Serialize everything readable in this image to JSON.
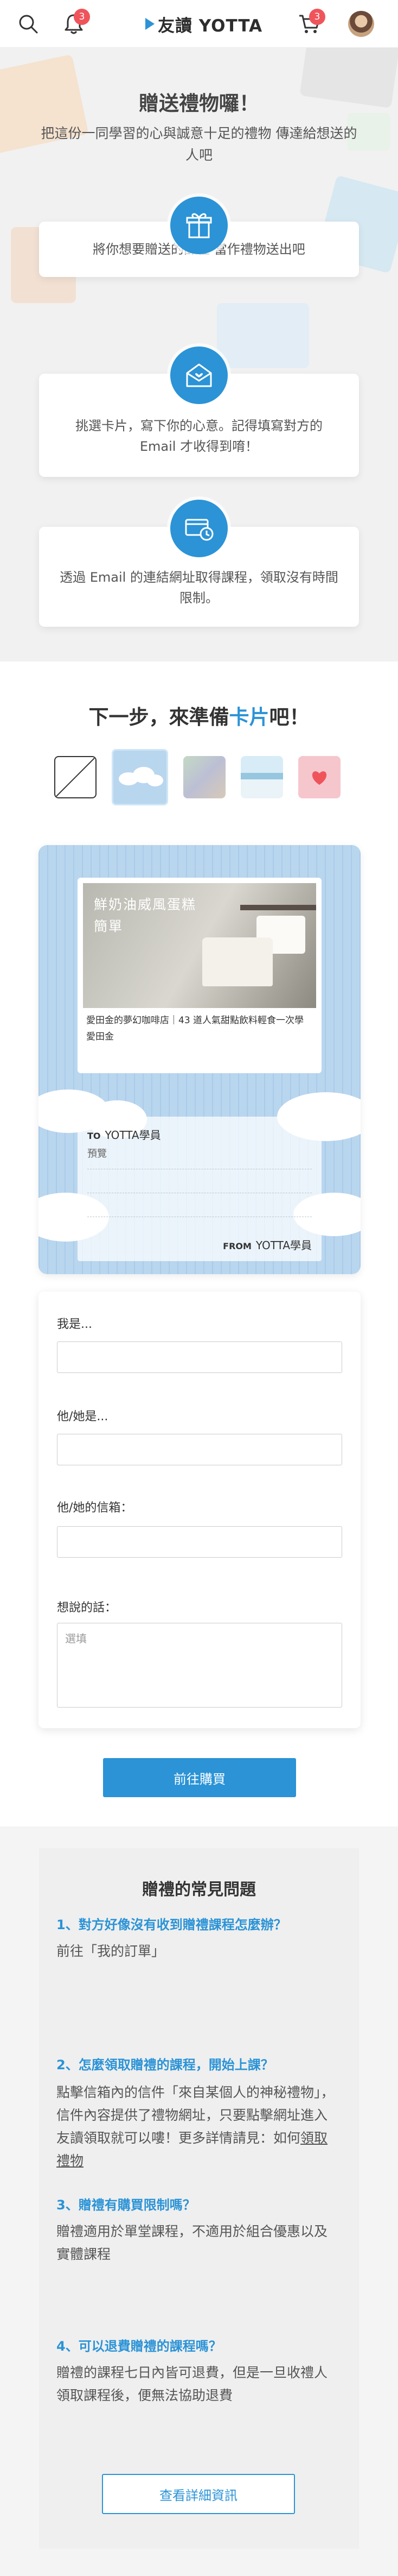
{
  "header": {
    "logo_text": "友讀 YOTTA",
    "notification_count": "3",
    "cart_count": "3"
  },
  "hero": {
    "title": "贈送禮物囉！",
    "subtitle": "把這份一同學習的心與誠意十足的禮物 傳達給想送的人吧",
    "steps": [
      {
        "icon": "gift-icon",
        "text": "將你想要贈送的課程 當作禮物送出吧"
      },
      {
        "icon": "mail-heart-icon",
        "text": "挑選卡片，寫下你的心意。記得填寫對方的 Email 才收得到唷！"
      },
      {
        "icon": "card-clock-icon",
        "text": "透過 Email 的連結網址取得課程，領取沒有時間限制。"
      }
    ]
  },
  "next_step": {
    "title_prefix": "下一步，來準備",
    "title_highlight": "卡片",
    "title_suffix": "吧！",
    "swatches": [
      {
        "name": "none",
        "color": "#ffffff"
      },
      {
        "name": "clouds",
        "color": "#b9d6ef"
      },
      {
        "name": "holo",
        "color": "#b8c8c0"
      },
      {
        "name": "sky",
        "color": "#a9d0e6"
      },
      {
        "name": "heart",
        "color": "#f6c6cd"
      }
    ]
  },
  "card": {
    "course_image_title": "鮮奶油威風蛋糕",
    "course_image_sub": "簡單",
    "course_desc": "愛田金的夢幻咖啡店｜43 道人氣甜點飲料輕食一次學 愛田金",
    "to_label": "TO",
    "to_name": "YOTTA學員",
    "preview_label": "預覽",
    "from_label": "FROM",
    "from_name": "YOTTA學員"
  },
  "form": {
    "me_label": "我是...",
    "recipient_label": "他/她是...",
    "email_label": "他/她的信箱：",
    "message_label": "想說的話：",
    "message_placeholder": "選填",
    "submit_label": "前往購買"
  },
  "faq": {
    "title": "贈禮的常見問題",
    "items": [
      {
        "q": "1、對方好像沒有收到贈禮課程怎麼辦？",
        "a": "前往「我的訂單」",
        "link": ""
      },
      {
        "q": "2、怎麼領取贈禮的課程，開始上課？",
        "a": "點擊信箱內的信件「來自某個人的神秘禮物」，信件內容提供了禮物網址，只要點擊網址進入友讀領取就可以嘍！更多詳情請見：如何",
        "link": "領取禮物"
      },
      {
        "q": "3、贈禮有購買限制嗎？",
        "a": "贈禮適用於單堂課程，不適用於組合優惠以及實體課程",
        "link": ""
      },
      {
        "q": "4、可以退費贈禮的課程嗎？",
        "a": "贈禮的課程七日內皆可退費，但是一旦收禮人領取課程後，便無法協助退費",
        "link": ""
      }
    ],
    "more_button": "查看詳細資訊"
  },
  "colors": {
    "accent": "#2b93d6",
    "badge": "#f0545b"
  }
}
